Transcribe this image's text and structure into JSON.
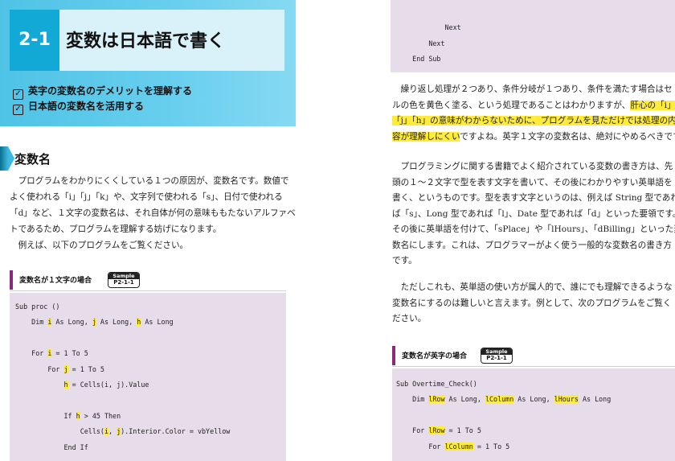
{
  "left_page": {
    "chapter_number": "2-1",
    "chapter_title": "変数は日本語で書く",
    "objectives": [
      "英字の変数名のデメリットを理解する",
      "日本語の変数名を活用する"
    ],
    "section_title": "変数名",
    "paragraph_lines": [
      "　プログラムをわかりにくくしている１つの原因が、変数名です。数値で",
      "よく使われる「i」「j」「k」や、文字列で使われる「s」、日付で使われる",
      "「d」など、１文字の変数名は、それ自体が何の意味ももたないアルファベッ",
      "トであるため、プログラムを理解する妨げになります。",
      "　例えば、以下のプログラムをご覧ください。"
    ],
    "sample_caption": "変数名が１文字の場合",
    "sample_badge_top": "Sample",
    "sample_badge_id": "P2-1-1",
    "code_lines": [
      {
        "indent": "",
        "segments": [
          {
            "t": "Sub proc ()",
            "hl": false
          }
        ]
      },
      {
        "indent": "    ",
        "segments": [
          {
            "t": "Dim ",
            "hl": false
          },
          {
            "t": "i",
            "hl": true
          },
          {
            "t": " As Long, ",
            "hl": false
          },
          {
            "t": "j",
            "hl": true
          },
          {
            "t": " As Long, ",
            "hl": false
          },
          {
            "t": "h",
            "hl": true
          },
          {
            "t": " As Long",
            "hl": false
          }
        ]
      },
      {
        "indent": "",
        "segments": []
      },
      {
        "indent": "    ",
        "segments": [
          {
            "t": "For ",
            "hl": false
          },
          {
            "t": "i",
            "hl": true
          },
          {
            "t": " = 1 To 5",
            "hl": false
          }
        ]
      },
      {
        "indent": "        ",
        "segments": [
          {
            "t": "For ",
            "hl": false
          },
          {
            "t": "j",
            "hl": true
          },
          {
            "t": " = 1 To 5",
            "hl": false
          }
        ]
      },
      {
        "indent": "            ",
        "segments": [
          {
            "t": "h",
            "hl": true
          },
          {
            "t": " = Cells(i, j).Value",
            "hl": false
          }
        ]
      },
      {
        "indent": "",
        "segments": []
      },
      {
        "indent": "            ",
        "segments": [
          {
            "t": "If ",
            "hl": false
          },
          {
            "t": "h",
            "hl": true
          },
          {
            "t": " > 45 Then",
            "hl": false
          }
        ]
      },
      {
        "indent": "                ",
        "segments": [
          {
            "t": "Cells(",
            "hl": false
          },
          {
            "t": "i",
            "hl": true
          },
          {
            "t": ", ",
            "hl": false
          },
          {
            "t": "j",
            "hl": true
          },
          {
            "t": ").Interior.Color = vbYellow",
            "hl": false
          }
        ]
      },
      {
        "indent": "            ",
        "segments": [
          {
            "t": "End If",
            "hl": false
          }
        ]
      }
    ]
  },
  "right_page": {
    "code_top_lines": [
      "            Next",
      "        Next",
      "    End Sub"
    ],
    "para1_lines": [
      [
        {
          "t": "　繰り返し処理が２つあり、条件分岐が１つあり、条件を満たす場合はセ",
          "hl": false
        }
      ],
      [
        {
          "t": "ルの色を黄色く塗る、という処理であることはわかりますが、",
          "hl": false
        },
        {
          "t": "肝心の「i」",
          "hl": true
        }
      ],
      [
        {
          "t": "「j」「h」の意味がわからないために、プログラムを見ただけでは処理の内",
          "hl": true
        }
      ],
      [
        {
          "t": "容が理解しにくい",
          "hl": true
        },
        {
          "t": "ですよね。英字１文字の変数名は、絶対にやめるべきです。",
          "hl": false
        }
      ]
    ],
    "para2_lines": [
      "　プログラミングに関する書籍でよく紹介されている変数の書き方は、先",
      "頭の１〜２文字で型を表す文字を書いて、その後にわかりやすい英単語を",
      "書く、というものです。型を表す文字というのは、例えば String 型であれ",
      "ば「s」、Long 型であれば「l」、Date 型であれば「d」といった要領です。",
      "その後に英単語を付けて、「sPlace」や「lHours」、「dBilling」といった変",
      "数名にします。これは、プログラマーがよく使う一般的な変数名の書き方",
      "です。"
    ],
    "para3_lines": [
      "　ただしこれも、英単語の使い方が属人的で、誰にでも理解できるような",
      "変数名にするのは難しいと言えます。例として、次のプログラムをご覧く",
      "ださい。"
    ],
    "sample_caption": "変数名が英字の場合",
    "sample_badge_top": "Sample",
    "sample_badge_id": "P2-1-1",
    "code_lines": [
      {
        "indent": "",
        "segments": [
          {
            "t": "Sub Overtime_Check()",
            "hl": false
          }
        ]
      },
      {
        "indent": "    ",
        "segments": [
          {
            "t": "Dim ",
            "hl": false
          },
          {
            "t": "lRow",
            "hl": true
          },
          {
            "t": " As Long, ",
            "hl": false
          },
          {
            "t": "lColumn",
            "hl": true
          },
          {
            "t": " As Long, ",
            "hl": false
          },
          {
            "t": "lHours",
            "hl": true
          },
          {
            "t": " As Long",
            "hl": false
          }
        ]
      },
      {
        "indent": "",
        "segments": []
      },
      {
        "indent": "    ",
        "segments": [
          {
            "t": "For ",
            "hl": false
          },
          {
            "t": "lRow",
            "hl": true
          },
          {
            "t": " = 1 To 5",
            "hl": false
          }
        ]
      },
      {
        "indent": "        ",
        "segments": [
          {
            "t": "For ",
            "hl": false
          },
          {
            "t": "lColumn",
            "hl": true
          },
          {
            "t": " = 1 To 5",
            "hl": false
          }
        ]
      }
    ]
  },
  "colors": {
    "header_blue": "#4fc3e6",
    "code_bg": "#e6dcea",
    "highlight": "#ffeb3b",
    "caption_bar": "#8a2a7e"
  }
}
